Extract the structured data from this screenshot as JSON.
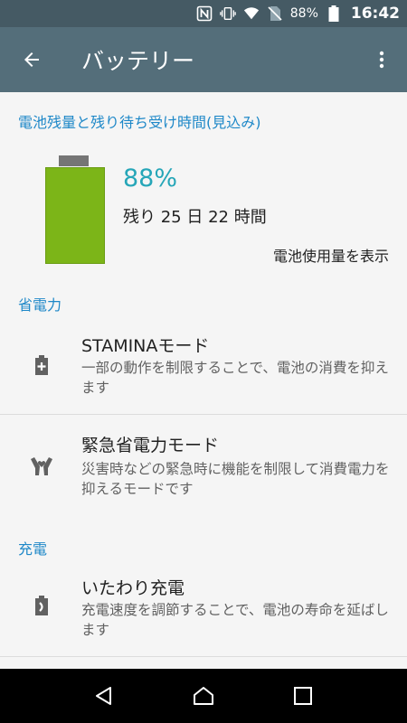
{
  "status_bar": {
    "battery_percent": "88%",
    "time": "16:42",
    "icons": [
      "nfc-icon",
      "vibrate-icon",
      "wifi-icon",
      "no-sim-icon",
      "battery-icon"
    ]
  },
  "app_bar": {
    "title": "バッテリー",
    "back_icon": "arrow-back-icon",
    "more_icon": "more-vert-icon"
  },
  "battery_section": {
    "header": "電池残量と残り待ち受け時間(見込み)",
    "percent": "88%",
    "level": 0.88,
    "remaining": "残り 25 日 22 時間",
    "usage_link": "電池使用量を表示"
  },
  "power_saving": {
    "header": "省電力",
    "items": [
      {
        "title": "STAMINAモード",
        "description": "一部の動作を制限することで、電池の消費を抑えます",
        "icon": "battery-plus-icon"
      },
      {
        "title": "緊急省電力モード",
        "description": "災害時などの緊急時に機能を制限して消費電力を抑えるモードです",
        "icon": "hands-heart-icon"
      }
    ]
  },
  "charging": {
    "header": "充電",
    "items": [
      {
        "title": "いたわり充電",
        "description": "充電速度を調節することで、電池の寿命を延ばします",
        "icon": "battery-care-icon"
      }
    ]
  },
  "nav_bar": {
    "icons": [
      "nav-back-icon",
      "nav-home-icon",
      "nav-recents-icon"
    ]
  },
  "colors": {
    "status_bar": "#455a64",
    "app_bar": "#546e7a",
    "accent": "#1e88c8",
    "battery_fill": "#7cb518",
    "percent_text": "#26a6b8"
  }
}
